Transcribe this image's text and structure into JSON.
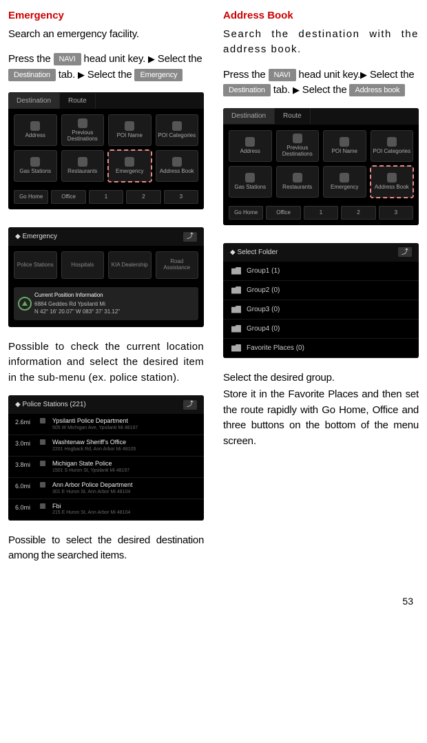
{
  "left": {
    "title": "Emergency",
    "intro": "Search an emergency facility.",
    "step1a": "Press the ",
    "navi": "NAVI",
    "step1b": " head unit key. ",
    "step2a": "Select the ",
    "destination": "Destination",
    "step2b": " tab. ",
    "step2c": " Select the ",
    "emergency": "Emergency",
    "screenshot1": {
      "tabs": [
        "Destination",
        "Route"
      ],
      "cells": [
        "Address",
        "Previous Destinations",
        "POI Name",
        "POI Categories",
        "Gas Stations",
        "Restaurants",
        "Emergency",
        "Address Book"
      ],
      "highlight_index": 6,
      "bottom": [
        "Go Home",
        "Office",
        "1",
        "2",
        "3"
      ]
    },
    "screenshot2": {
      "title": "Emergency",
      "cells": [
        "Police Stations",
        "Hospitals",
        "KIA Dealership",
        "Road Assistance"
      ],
      "pos_title": "Current Position Information",
      "pos_addr": "6884 Geddes Rd Ypsilanti Mi",
      "pos_coord": "N 42° 16' 20.07\"   W 083° 37' 31.12\""
    },
    "caption1": "Possible to check the current loca­tion information and select the desired item in the sub-menu (ex. police station).",
    "screenshot3": {
      "title": "Police Stations (221)",
      "rows": [
        {
          "dist": "2.6mi",
          "name": "Ypsilanti Police Department",
          "addr": "505 W Michigan Ave, Ypsilanti Mi 48197"
        },
        {
          "dist": "3.0mi",
          "name": "Washtenaw Sheriff's Office",
          "addr": "2201 Hogback Rd, Ann Arbor Mi 48105"
        },
        {
          "dist": "3.8mi",
          "name": "Michigan State Police",
          "addr": "1501 S Huron St, Ypsilanti Mi 48197"
        },
        {
          "dist": "6.0mi",
          "name": "Ann Arbor Police Department",
          "addr": "301 E Huron St, Ann Arbor Mi 48104"
        },
        {
          "dist": "6.0mi",
          "name": "Fbi",
          "addr": "215 E Huron St, Ann Arbor Mi 48104"
        }
      ]
    },
    "caption2": "Possible to select the desired destina­tion among the searched items."
  },
  "right": {
    "title": "Address Book",
    "intro": "Search the destination with the address book.",
    "step1a": "Press the ",
    "navi": "NAVI",
    "step1b": " head unit key.",
    "step2a": "Select the ",
    "destination": "Destination",
    "step2b": " tab. ",
    "step2c": " Select the ",
    "addressbook": "Address book",
    "screenshot1": {
      "tabs": [
        "Destination",
        "Route"
      ],
      "cells": [
        "Address",
        "Previous Destinations",
        "POI Name",
        "POI Categories",
        "Gas Stations",
        "Restaurants",
        "Emergency",
        "Address Book"
      ],
      "highlight_index": 7,
      "bottom": [
        "Go Home",
        "Office",
        "1",
        "2",
        "3"
      ]
    },
    "screenshot2": {
      "title": "Select Folder",
      "rows": [
        "Group1 (1)",
        "Group2 (0)",
        "Group3 (0)",
        "Group4 (0)",
        "Favorite Places (0)"
      ]
    },
    "caption1": "Select the desired group.",
    "caption2": "Store it in the Favorite Places and then set the route rapidly with Go Home, Office and three buttons on the bottom of the menu screen."
  },
  "page_number": "53"
}
